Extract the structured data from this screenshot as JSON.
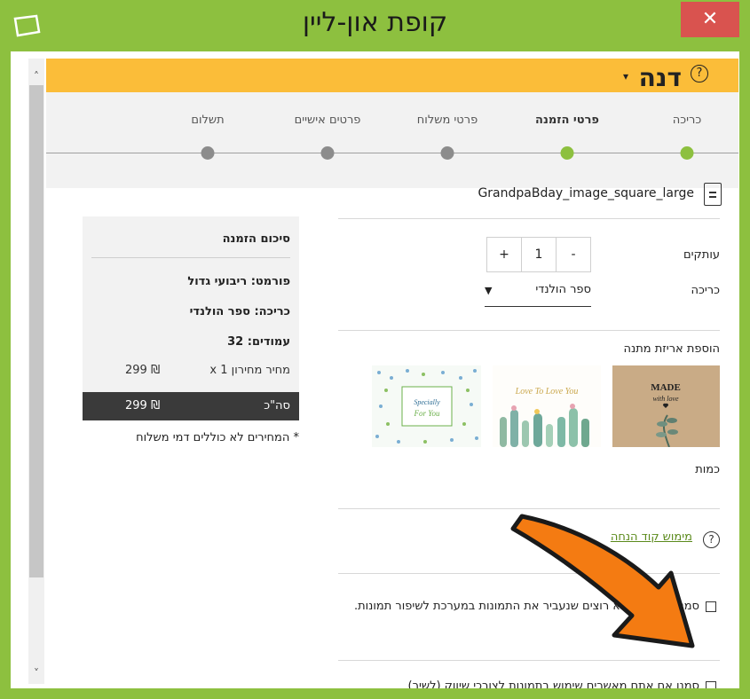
{
  "window": {
    "title": "קופת און-ליין",
    "close_label": "✕",
    "accent_color": "#8dc03f"
  },
  "header": {
    "user_name": "דנה",
    "caret": "▾",
    "help_label": "?"
  },
  "steps": [
    {
      "label": "כריכה",
      "state": "done"
    },
    {
      "label": "פרטי הזמנה",
      "state": "current"
    },
    {
      "label": "פרטי משלוח",
      "state": "pending"
    },
    {
      "label": "פרטים אישיים",
      "state": "pending"
    },
    {
      "label": "תשלום",
      "state": "pending"
    }
  ],
  "form": {
    "file_name": "GrandpaBday_image_square_large",
    "copies_label": "עותקים",
    "copies_minus": "-",
    "copies_value": "1",
    "copies_plus": "+",
    "binding_label": "כריכה",
    "binding_value": "ספר הולנדי",
    "gift_wrap_label": "הוספת אריזת מתנה",
    "gift_cards": [
      {
        "name": "made-with-love",
        "text": "MADE with love"
      },
      {
        "name": "love-you",
        "text": "Love To Love You"
      },
      {
        "name": "specially-for-you",
        "text": "Specially For You"
      }
    ],
    "quantity_label": "כמות",
    "redeem_link": "מימוש קוד הנחה",
    "checkbox1_text": "סמנו אם אתם לא רוצים שנעביר את התמונות במערכת לשיפור תמונות.",
    "checkbox2_text": "סמנו אם אתם מאשרים שימוש בתמונות לצורכי שיווק (לשיר)"
  },
  "summary": {
    "title": "סיכום הזמנה",
    "format": "פורמט: ריבועי גדול",
    "binding": "כריכה: ספר הולנדי",
    "pages": "עמודים: 32",
    "price_label": "מחיר מחירון x 1",
    "price_value": "299 ₪",
    "total_label": "סה\"כ",
    "total_value": "299 ₪",
    "note": "* המחירים לא כוללים דמי משלוח"
  },
  "scrollbar": {
    "up": "˄",
    "down": "˅"
  }
}
